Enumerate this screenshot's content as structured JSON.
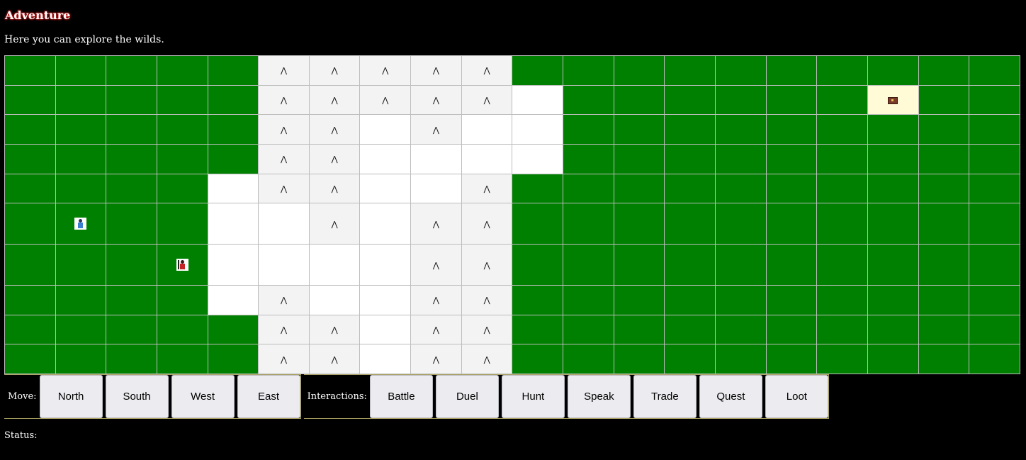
{
  "page": {
    "title": "Adventure",
    "subtitle": "Here you can explore the wilds."
  },
  "map": {
    "legend": {
      "G": "grass",
      "S": "snow",
      "M": "mountain",
      "C": "chest",
      "P": "player",
      "N": "npc"
    },
    "rows": [
      "GGGGGMMMMMGGGGGGGGGG",
      "GGGGGMMMMMSGGGGGGCGG",
      "GGGGGMMSMSSGGGGGGGGG",
      "GGGGGMMSSSSGGGGGGGGG",
      "GGGGSMMSSMGGGGGGGGGG",
      "GNGGSSMSMMGGGGGGGGGG",
      "GGGPSSSSMMGGGGGGGGGG",
      "GGGGSMSSMMGGGGGGGGGG",
      "GGGGGMMSMMGGGGGGGGGG",
      "GGGGGMMSMMGGGGGGGGGG"
    ],
    "icons": {
      "mountain": "mountain-icon",
      "chest": "treasure-chest-icon",
      "player": "player-character-icon",
      "npc": "npc-character-icon"
    },
    "colors": {
      "grass": "#008000",
      "snow": "#ffffff",
      "mountain": "#f3f3f3",
      "chest": "#fffbd6"
    }
  },
  "move": {
    "label": "Move:",
    "buttons": [
      "North",
      "South",
      "West",
      "East"
    ]
  },
  "interactions": {
    "label": "Interactions:",
    "buttons": [
      "Battle",
      "Duel",
      "Hunt",
      "Speak",
      "Trade",
      "Quest",
      "Loot"
    ]
  },
  "status": {
    "label": "Status:",
    "text": ""
  }
}
